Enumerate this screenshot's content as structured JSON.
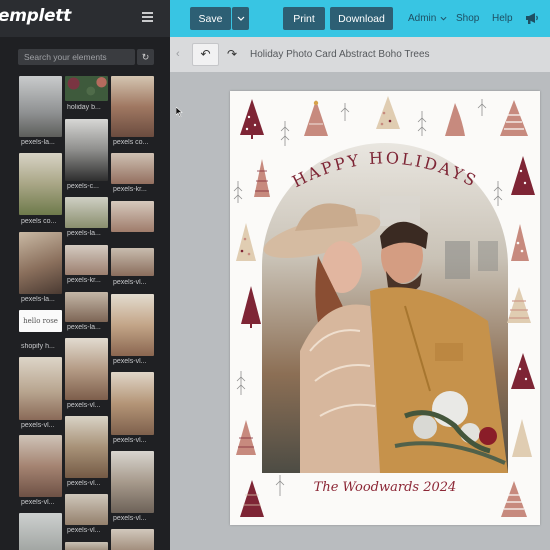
{
  "app": {
    "brand": "emplett"
  },
  "toolbar": {
    "save_label": "Save",
    "print_label": "Print",
    "download_label": "Download",
    "admin_label": "Admin",
    "shop_label": "Shop",
    "help_label": "Help"
  },
  "sidebar": {
    "search_placeholder": "Search your elements",
    "thumbnails": [
      {
        "label": "pexels-la..."
      },
      {
        "label": "holiday b..."
      },
      {
        "label": "pexels co..."
      },
      {
        "label": "pexels-c..."
      },
      {
        "label": "pexels-kr..."
      },
      {
        "label": "pexels co..."
      },
      {
        "label": "pexels-la..."
      },
      {
        "label": "pexels-la..."
      },
      {
        "label": "pexels-kr..."
      },
      {
        "label": "pexels-vl..."
      },
      {
        "label": "pexels-la..."
      },
      {
        "label": "pexels-vl..."
      },
      {
        "label": "shopify h..."
      },
      {
        "label": "pexels-vl..."
      },
      {
        "label": "pexels-vl..."
      },
      {
        "label": "pexels-vl..."
      },
      {
        "label": "pexels-vl..."
      },
      {
        "label": "pexels-vl..."
      },
      {
        "label": "pexels-vl..."
      },
      {
        "label": "pexels-vl..."
      },
      {
        "label": "pexels-vl..."
      },
      {
        "label": "pexels-vl..."
      }
    ],
    "logo_thumb_text": "hello rose"
  },
  "editor": {
    "document_title": "Holiday Photo Card Abstract Boho Trees"
  },
  "card": {
    "headline": "HAPPY HOLIDAYS",
    "signature": "The Woodwards 2024",
    "colors": {
      "burgundy": "#7e2535",
      "rose": "#c78a7e",
      "sand": "#e0cdb2",
      "paper": "#fbfaf8"
    }
  }
}
